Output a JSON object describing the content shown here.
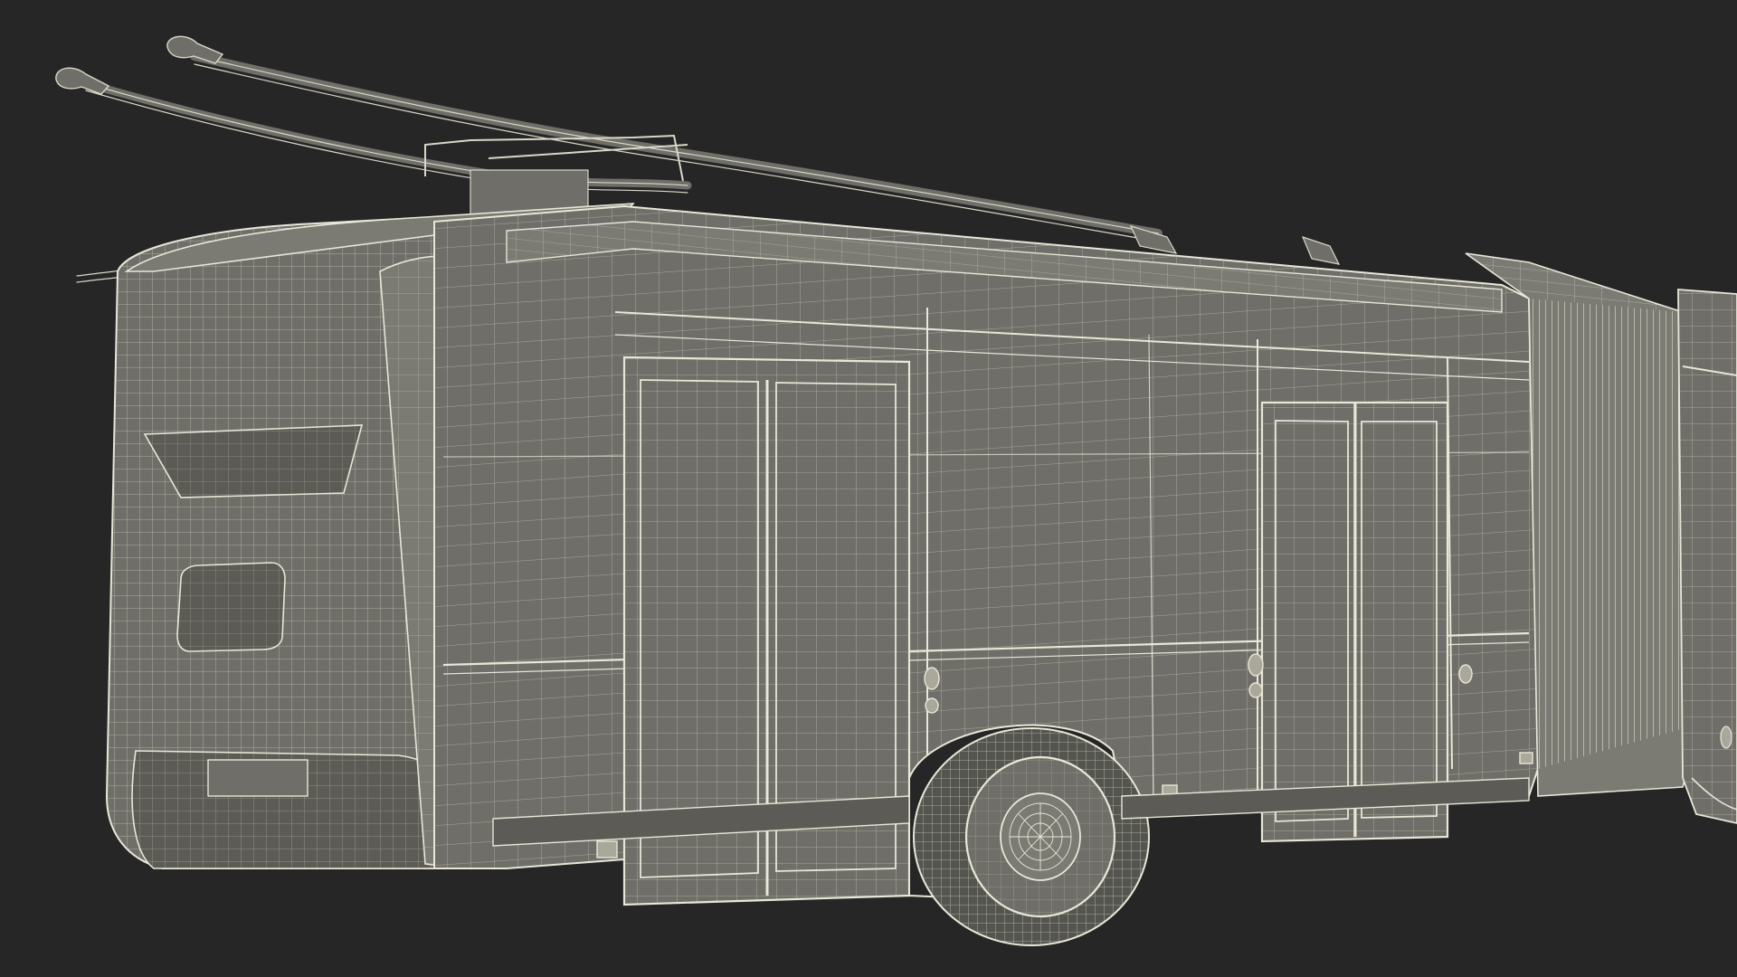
{
  "scene": {
    "subject": "articulated-trolleybus-wireframe",
    "render_style": "wireframe",
    "colors": {
      "background": "#262626",
      "body_fill": "#6f6e68",
      "body_fill_light": "#7b7a73",
      "body_fill_dark": "#5c5b55",
      "wire": "#d9d8c8",
      "wire_dim": "#a9a89a",
      "edge": "#e8e7d8",
      "tire": "#555550"
    }
  }
}
